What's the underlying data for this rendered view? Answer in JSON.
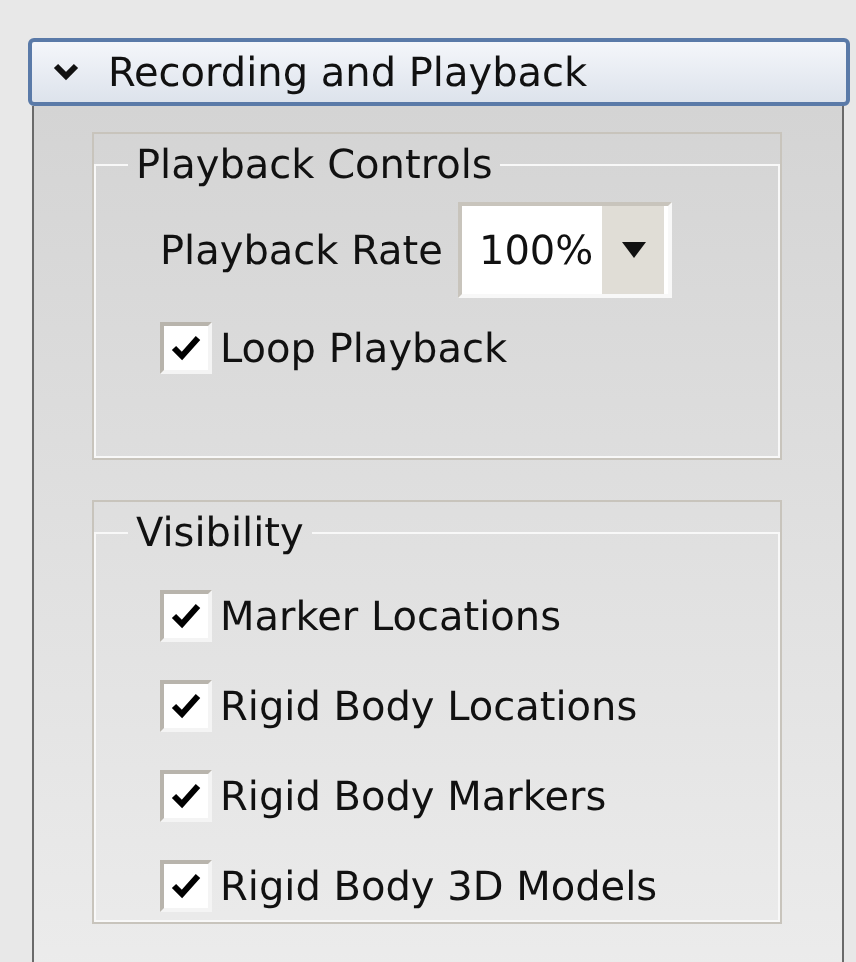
{
  "section": {
    "title": "Recording and Playback",
    "expanded": true
  },
  "playback_controls": {
    "title": "Playback Controls",
    "rate_label": "Playback Rate",
    "rate_value": "100%",
    "checkboxes": [
      {
        "label": "Loop Playback",
        "checked": true
      }
    ]
  },
  "visibility": {
    "title": "Visibility",
    "checkboxes": [
      {
        "label": "Marker Locations",
        "checked": true
      },
      {
        "label": "Rigid Body Locations",
        "checked": true
      },
      {
        "label": "Rigid Body Markers",
        "checked": true
      },
      {
        "label": "Rigid Body 3D Models",
        "checked": true
      }
    ]
  }
}
